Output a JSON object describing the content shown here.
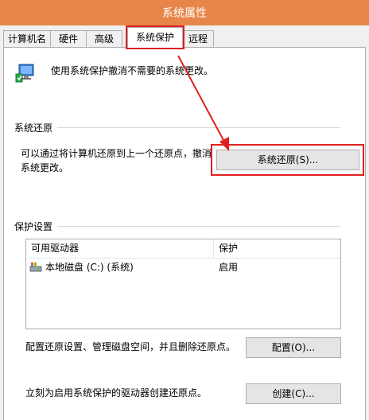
{
  "window": {
    "title": "系统属性"
  },
  "tabs": [
    {
      "label": "计算机名"
    },
    {
      "label": "硬件"
    },
    {
      "label": "高级"
    },
    {
      "label": "系统保护"
    },
    {
      "label": "远程"
    }
  ],
  "intro": {
    "text": "使用系统保护撤消不需要的系统更改。"
  },
  "restore": {
    "section_label": "系统还原",
    "description_line1": "可以通过将计算机还原到上一个还原点，撤消",
    "description_line2": "系统更改。",
    "button_label": "系统还原(S)..."
  },
  "protection": {
    "section_label": "保护设置",
    "columns": [
      "可用驱动器",
      "保护"
    ],
    "drives": [
      {
        "name": "本地磁盘 (C:) (系统)",
        "status": "启用"
      }
    ],
    "configure_text": "配置还原设置、管理磁盘空间，并且删除还原点。",
    "configure_button": "配置(O)...",
    "create_text": "立刻为启用系统保护的驱动器创建还原点。",
    "create_button": "创建(C)..."
  },
  "colors": {
    "titlebar": "#e8864a",
    "highlight": "#e02020"
  },
  "icons": [
    "system-protection-icon",
    "drive-icon"
  ]
}
